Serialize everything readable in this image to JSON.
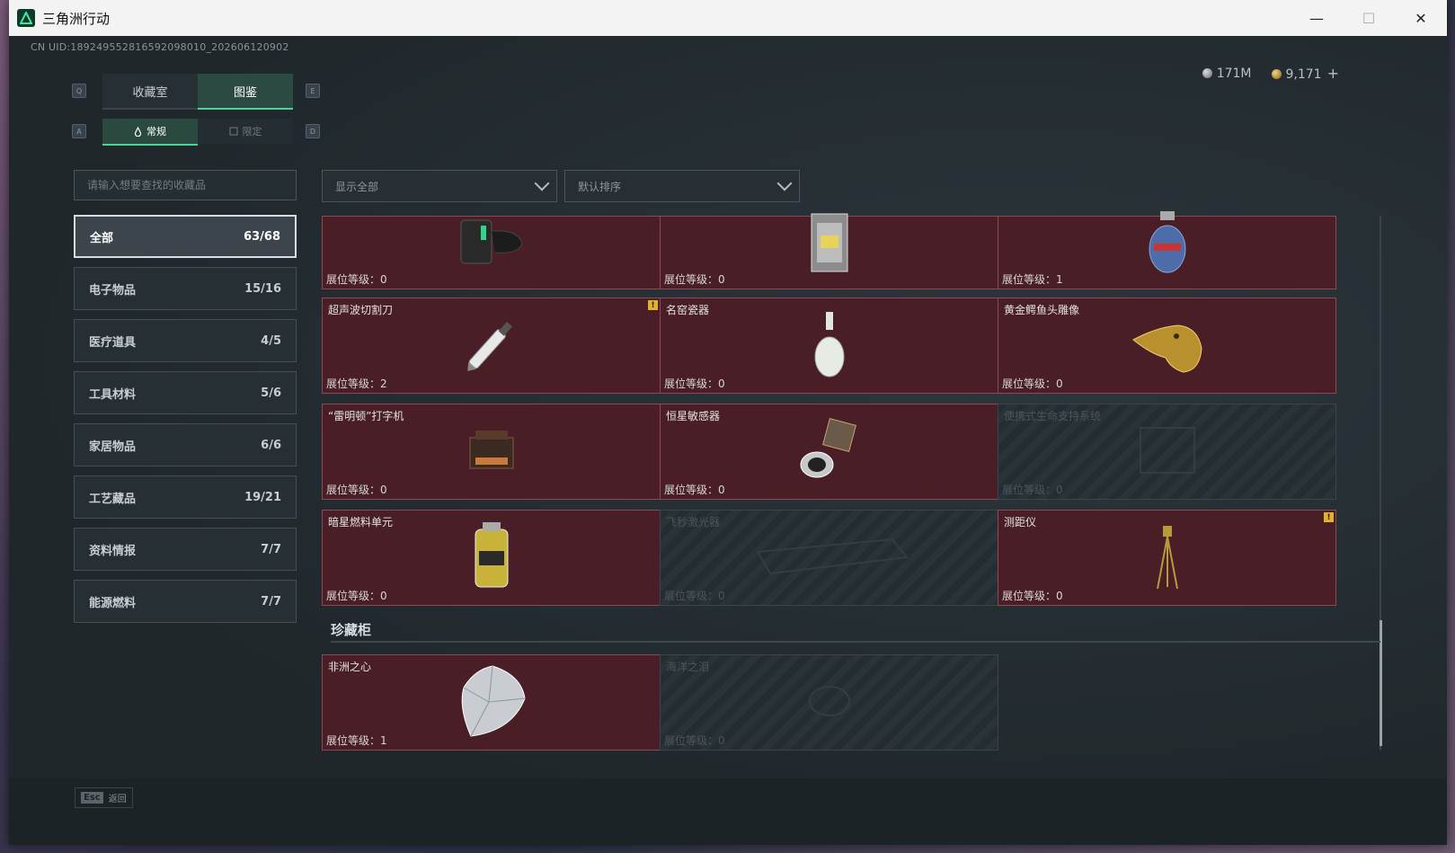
{
  "window": {
    "title": "三角洲行动"
  },
  "header": {
    "uid": "CN UID:189249552816592098010_202606120902",
    "silver": "171M",
    "gold": "9,171",
    "plus": "+"
  },
  "keys": {
    "tab_left": "Q",
    "tab_right": "E",
    "sub_left": "A",
    "sub_right": "D"
  },
  "tabs": [
    {
      "label": "收藏室"
    },
    {
      "label": "图鉴"
    }
  ],
  "subtabs": [
    {
      "label": "常规"
    },
    {
      "label": "限定"
    }
  ],
  "search": {
    "placeholder": "请输入想要查找的收藏品"
  },
  "filters": {
    "show": "显示全部",
    "sort": "默认排序"
  },
  "categories": [
    {
      "label": "全部",
      "count": "63/68"
    },
    {
      "label": "电子物品",
      "count": "15/16"
    },
    {
      "label": "医疗道具",
      "count": "4/5"
    },
    {
      "label": "工具材料",
      "count": "5/6"
    },
    {
      "label": "家居物品",
      "count": "6/6"
    },
    {
      "label": "工艺藏品",
      "count": "19/21"
    },
    {
      "label": "资料情报",
      "count": "7/7"
    },
    {
      "label": "能源燃料",
      "count": "7/7"
    }
  ],
  "level_label": "展位等级：",
  "items": [
    {
      "name": "",
      "level": "0",
      "icon": "device-icon"
    },
    {
      "name": "",
      "level": "0",
      "icon": "lantern-icon"
    },
    {
      "name": "",
      "level": "1",
      "icon": "gas-tank-icon"
    },
    {
      "name": "超声波切割刀",
      "level": "2",
      "icon": "cutter-icon",
      "badge": "!"
    },
    {
      "name": "名窑瓷器",
      "level": "0",
      "icon": "vase-icon"
    },
    {
      "name": "黄金鳄鱼头雕像",
      "level": "0",
      "icon": "croc-statue-icon"
    },
    {
      "name": "“雷明顿”打字机",
      "level": "0",
      "icon": "typewriter-icon"
    },
    {
      "name": "恒星敏感器",
      "level": "0",
      "icon": "sensor-icon"
    },
    {
      "name": "便携式生命支持系统",
      "level": "0",
      "icon": "life-support-icon",
      "locked": true
    },
    {
      "name": "暗星燃料单元",
      "level": "0",
      "icon": "fuel-cell-icon"
    },
    {
      "name": "飞秒激光器",
      "level": "0",
      "icon": "laser-icon",
      "locked": true
    },
    {
      "name": "测距仪",
      "level": "0",
      "icon": "rangefinder-icon",
      "badge": "!"
    }
  ],
  "cabinet": {
    "title": "珍藏柜",
    "items": [
      {
        "name": "非洲之心",
        "level": "1",
        "icon": "diamond-icon"
      },
      {
        "name": "海洋之泪",
        "level": "0",
        "icon": "gem-icon",
        "locked": true
      }
    ]
  },
  "footer": {
    "key": "Esc",
    "label": "返回"
  }
}
